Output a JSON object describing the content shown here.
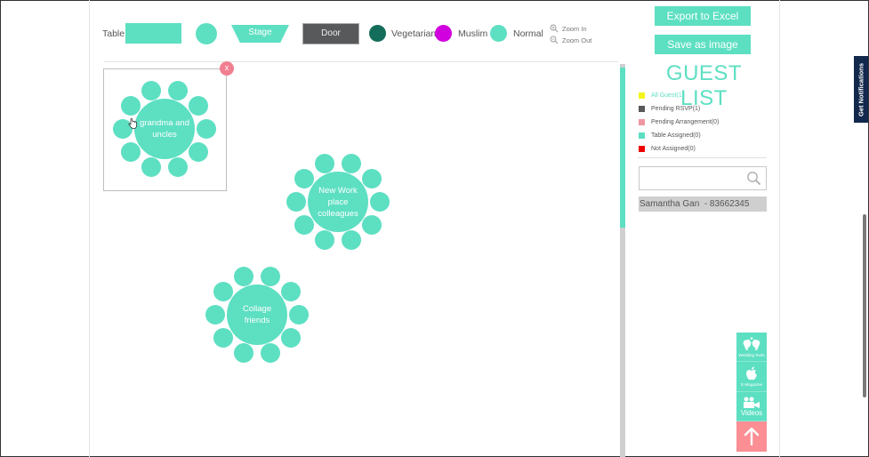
{
  "toolbar": {
    "table_label": "Table",
    "stage_label": "Stage",
    "door_label": "Door",
    "diet_legend": [
      {
        "label": "Vegetarian",
        "color": "#136d5a"
      },
      {
        "label": "Muslim",
        "color": "#d100de"
      },
      {
        "label": "Normal",
        "color": "#5ddfc2"
      }
    ],
    "zoom_in_label": "Zoom In",
    "zoom_out_label": "Zoom Out"
  },
  "floorplan": {
    "accent_color": "#5ddfc2",
    "remove_label": "x",
    "tables": [
      {
        "name": "grandma and uncles",
        "seats": 10,
        "selected": true
      },
      {
        "name": "New Work place colleagues",
        "seats": 10,
        "selected": false
      },
      {
        "name": "Collage friends",
        "seats": 10,
        "selected": false
      }
    ]
  },
  "sidebar": {
    "export_label": "Export to Excel",
    "save_image_label": "Save as image",
    "title": "GUEST LIST",
    "filters": [
      {
        "label": "All Guest(1)",
        "color": "#f6f51b",
        "active": true
      },
      {
        "label": "Pending RSVP(1)",
        "color": "#58595b",
        "active": false
      },
      {
        "label": "Pending Arrangement(0)",
        "color": "#ef96a2",
        "active": false
      },
      {
        "label": "Table Assigned(0)",
        "color": "#5ddfc2",
        "active": false
      },
      {
        "label": "Not Assigned(0)",
        "color": "#ee0000",
        "active": false
      }
    ],
    "search_placeholder": "",
    "search_value": "",
    "guests": [
      {
        "label": "Samantha Gan  - 83662345"
      }
    ]
  },
  "side_tools": {
    "wedding_tools_label": "Wedding Tools",
    "emagazine_label": "E-Magazine",
    "videos_label": "Videos"
  },
  "notifications": {
    "label": "Get Notifications"
  }
}
